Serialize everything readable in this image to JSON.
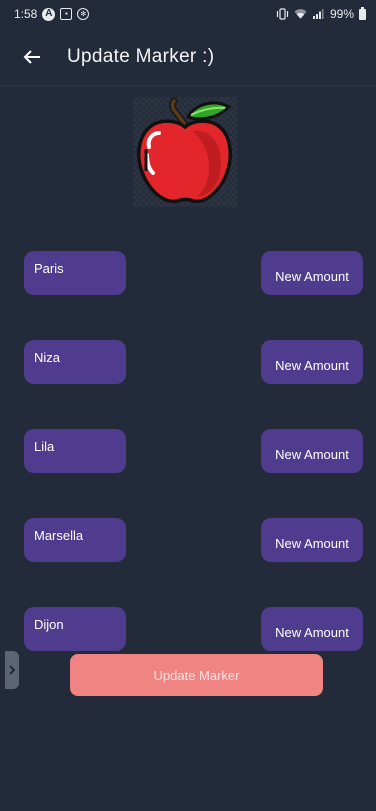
{
  "status_bar": {
    "time": "1:58",
    "icons": [
      "auto-icon",
      "gallery-icon",
      "accessibility-icon"
    ],
    "battery": "99%"
  },
  "app_bar": {
    "back_icon": "arrow-left-icon",
    "title": "Update Marker :)"
  },
  "image": {
    "icon": "apple-icon"
  },
  "markers": [
    {
      "name": "Paris",
      "action_label": "New Amount"
    },
    {
      "name": "Niza",
      "action_label": "New Amount"
    },
    {
      "name": "Lila",
      "action_label": "New Amount"
    },
    {
      "name": "Marsella",
      "action_label": "New Amount"
    },
    {
      "name": "Dijon",
      "action_label": "New Amount"
    }
  ],
  "update_button": {
    "label": "Update Marker"
  },
  "colors": {
    "background": "#232b3a",
    "chip": "#4f3c8e",
    "update_button": "#f08482"
  }
}
